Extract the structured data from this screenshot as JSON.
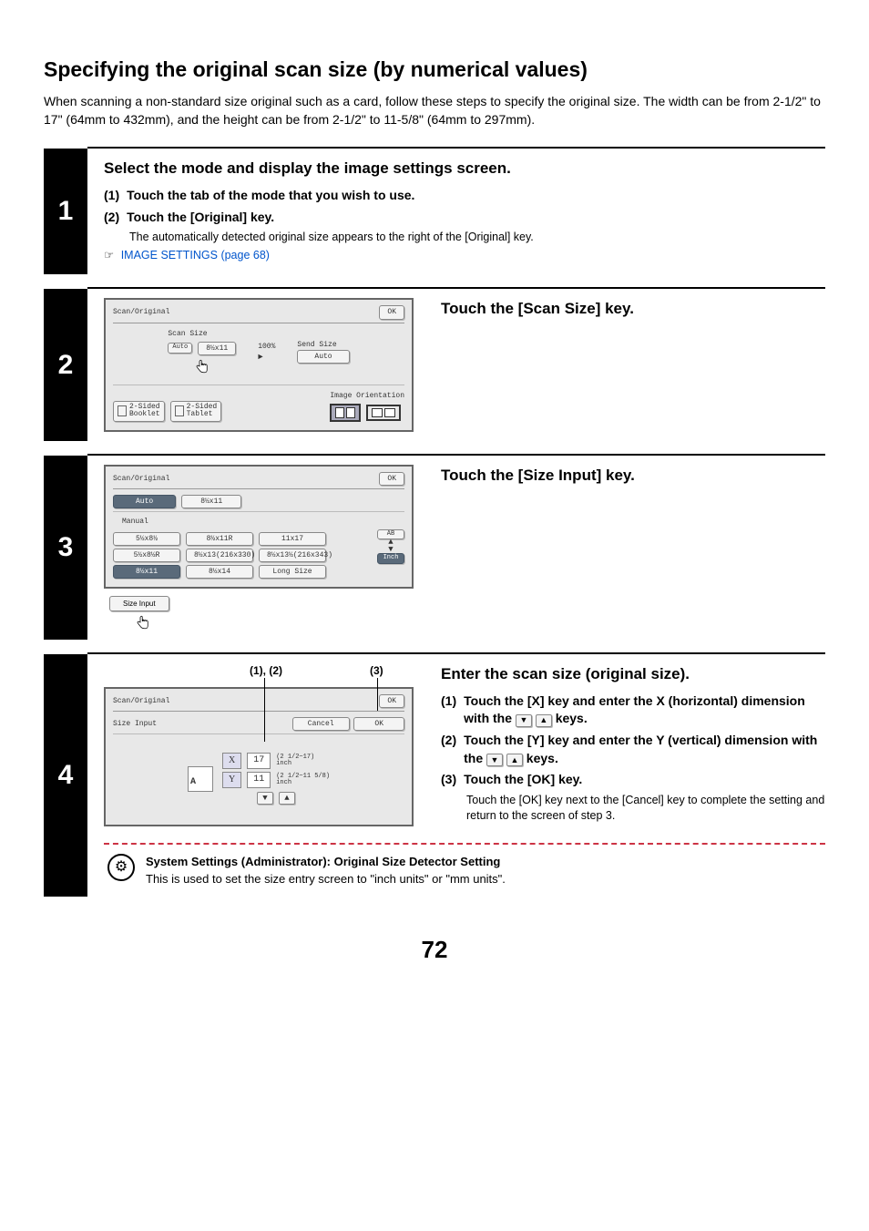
{
  "heading": "Specifying the original scan size (by numerical values)",
  "intro": "When scanning a non-standard size original such as a card, follow these steps to specify the original size. The width can be from 2-1/2\" to 17\" (64mm to 432mm), and the height can be from 2-1/2\" to 11-5/8\" (64mm to 297mm).",
  "step1": {
    "num": "1",
    "title": "Select the mode and display the image settings screen.",
    "sub1_idx": "(1)",
    "sub1": "Touch the tab of the mode that you wish to use.",
    "sub2_idx": "(2)",
    "sub2": "Touch the [Original] key.",
    "desc": "The automatically detected original size appears to the right of the [Original] key.",
    "link": "IMAGE SETTINGS (page 68)"
  },
  "step2": {
    "num": "2",
    "title": "Touch the [Scan Size] key.",
    "panel": {
      "title": "Scan/Original",
      "ok": "OK",
      "scan_size_lbl": "Scan Size",
      "ratio": "100%",
      "send_size_lbl": "Send Size",
      "auto": "Auto",
      "scan_val": "8½x11",
      "send_val": "Auto",
      "duplex_booklet": "2-Sided\nBooklet",
      "duplex_tablet": "2-Sided\nTablet",
      "orient_lbl": "Image Orientation"
    }
  },
  "step3": {
    "num": "3",
    "title": "Touch the [Size Input] key.",
    "panel": {
      "title": "Scan/Original",
      "ok": "OK",
      "tab_auto": "Auto",
      "tab_size": "8½x11",
      "manual": "Manual",
      "sizes": [
        "5½x8½",
        "8½x11R",
        "11x17",
        "5½x8½R",
        "8½x13(216x330)",
        "8½x13½(216x343)",
        "8½x11",
        "8½x14",
        "Long Size"
      ],
      "ab": "AB",
      "inch": "Inch",
      "size_input": "Size Input"
    }
  },
  "step4": {
    "num": "4",
    "title": "Enter the scan size (original size).",
    "sub1_idx": "(1)",
    "sub1_a": "Touch the [X] key and enter the X (horizontal) dimension with the ",
    "sub1_b": " keys.",
    "sub2_idx": "(2)",
    "sub2_a": "Touch the [Y] key and enter the Y (vertical) dimension with the ",
    "sub2_b": " keys.",
    "sub3_idx": "(3)",
    "sub3": "Touch the [OK] key.",
    "sub3_desc": "Touch the [OK] key next to the [Cancel] key to complete the setting and return to the screen of step 3.",
    "anno12": "(1), (2)",
    "anno3": "(3)",
    "panel": {
      "title": "Scan/Original",
      "ok": "OK",
      "size_input": "Size Input",
      "cancel": "Cancel",
      "ok2": "OK",
      "x": "X",
      "x_val": "17",
      "x_range": "(2 1/2~17)\ninch",
      "y": "Y",
      "y_val": "11",
      "y_range": "(2 1/2~11 5/8)\ninch"
    }
  },
  "admin": {
    "title": "System Settings (Administrator): Original Size Detector Setting",
    "desc": "This is used to set the size entry screen to \"inch units\" or \"mm units\"."
  },
  "page_num": "72"
}
